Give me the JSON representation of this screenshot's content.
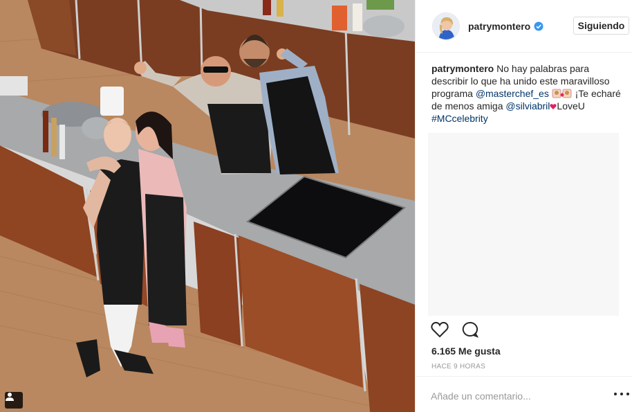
{
  "post": {
    "username": "patrymontero",
    "follow_label": "Siguiendo",
    "caption": {
      "username": "patrymontero",
      "text_1": " No hay palabras para describir lo que ha unido este maravilloso programa ",
      "mention_1": "@masterchef_es",
      "text_2": " ¡Te echaré de menos amiga ",
      "mention_2": "@silviabril",
      "text_3": "LoveU",
      "hashtag": "#MCcelebrity"
    },
    "likes": "6.165 Me gusta",
    "time_ago": "HACE 9 HORAS",
    "comment_placeholder": "Añade un comentario..."
  },
  "icons": [
    "user-tag-icon",
    "verified-icon",
    "heart-icon",
    "comment-icon",
    "more-options-icon"
  ],
  "colors": {
    "link": "#003569",
    "verified": "#3897f0",
    "text": "#262626",
    "muted": "#999999",
    "border": "#efefef"
  }
}
